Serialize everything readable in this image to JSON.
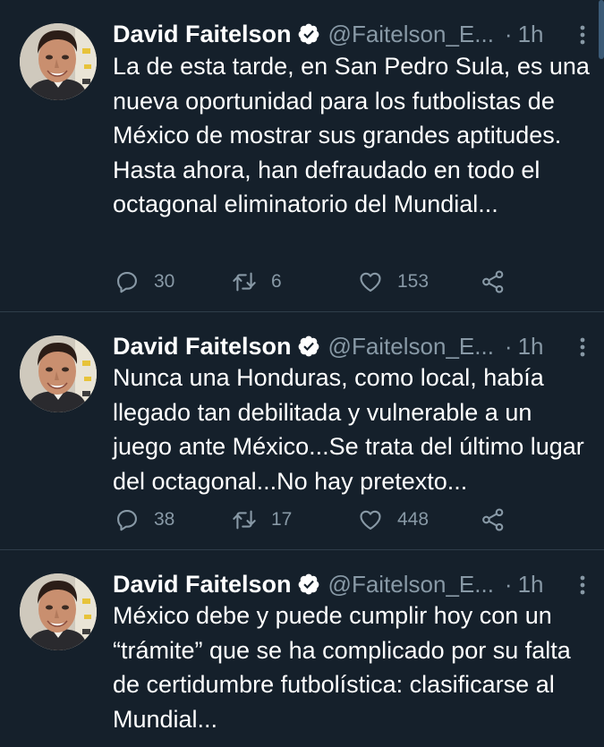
{
  "colors": {
    "background": "#15202b",
    "text_primary": "#ffffff",
    "text_secondary": "#8899a6",
    "divider": "#2f3d4a",
    "verified_badge": "#ffffff"
  },
  "tweets": [
    {
      "author_name": "David Faitelson",
      "handle": "@Faitelson_E...",
      "separator": "·",
      "time": "1h",
      "verified": true,
      "text": "La de esta tarde, en San Pedro Sula, es una nueva oportunidad para los futbolistas de México de mostrar sus grandes aptitudes. Hasta ahora, han defraudado en todo el octagonal eliminatorio del Mundial...",
      "replies": "30",
      "retweets": "6",
      "likes": "153",
      "icons": [
        "verified-badge-icon",
        "more-options-icon",
        "reply-icon",
        "retweet-icon",
        "like-icon",
        "share-icon"
      ]
    },
    {
      "author_name": "David Faitelson",
      "handle": "@Faitelson_E...",
      "separator": "·",
      "time": "1h",
      "verified": true,
      "text": "Nunca una Honduras, como local, había llegado tan debilitada y vulnerable a un juego ante México...Se trata del último lugar del octagonal...No hay pretexto...",
      "replies": "38",
      "retweets": "17",
      "likes": "448",
      "icons": [
        "verified-badge-icon",
        "more-options-icon",
        "reply-icon",
        "retweet-icon",
        "like-icon",
        "share-icon"
      ]
    },
    {
      "author_name": "David Faitelson",
      "handle": "@Faitelson_E...",
      "separator": "·",
      "time": "1h",
      "verified": true,
      "text": "México debe y puede cumplir hoy con un “trámite” que se ha complicado por su falta de certidumbre futbolística: clasificarse al Mundial...",
      "icons": [
        "verified-badge-icon",
        "more-options-icon"
      ]
    }
  ]
}
